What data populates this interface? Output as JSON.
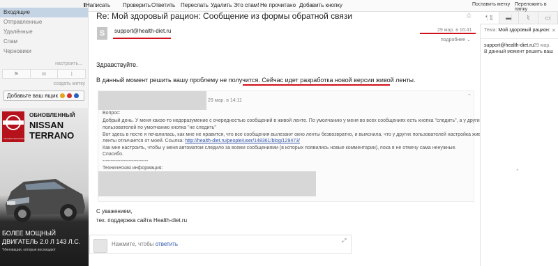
{
  "sidebar": {
    "folders": [
      "Входящие",
      "Отправленные",
      "Удалённые",
      "Спам",
      "Черновики"
    ],
    "configure": "настроить...",
    "create_note": "создать метку",
    "add_box": "Добавьте ваш ящик"
  },
  "ad": {
    "badge_tag": "Innovation that excites",
    "line1": "ОБНОВЛЕННЫЙ",
    "line2": "NISSAN",
    "line3": "TERRANO",
    "bottom1": "БОЛЕЕ МОЩНЫЙ",
    "bottom2": "ДВИГАТЕЛЬ 2.0 Л 143 Л.С.",
    "bottom3": "*Инновации, которые восхищают"
  },
  "toolbar": {
    "buttons": [
      "Написать",
      "Проверить",
      "Ответить",
      "Переслать",
      "Удалить",
      "Это спам!",
      "Не прочитано",
      "Добавить кнопку"
    ],
    "right1": "Поставить метку",
    "right2": "Переложить в папку"
  },
  "message": {
    "subject": "Re: Мой здоровый рацион: Сообщение из формы обратной связи",
    "avatar_letter": "S",
    "sender": "support@health-diet.ru",
    "date": "29 мар. в 16:41",
    "more": "подробнее",
    "greeting": "Здравствуйте.",
    "line1_a": "В данный момент решить вашу проблему не получится. ",
    "line1_b": "Сейчас идет разработка новой версии живой ленты.",
    "quote": {
      "date": "29 мар. в 14:11",
      "label": "Вопрос:",
      "p1": "Добрый день. У меня какое-то недоразумение с очередностью сообщений в живой ленте. По умолчанию у меня во всех сообщениях есть кнопка \"следить\", а у других",
      "p2": "пользователей по умолчанию кнопка \"не следить\"",
      "p3": "Вот здесь в посте я печалилась, как мне не нравится, что все сообщения вылезают окно ленты безвозвратно, и выяснила, что у других пользователей настройка живой",
      "p4_a": "ленты отличается от моей. Ссылка: ",
      "p4_link": "http://health-diet.ru/people/user/148361/blog/129473/",
      "p5": "Как мне настроить, чтобы у меня автоматом следило за всеми сообщениями (в которых появились новые комментарии), пока я не отмечу сама ненужные.",
      "p6": "Спасибо.",
      "p7": "----------------------------",
      "p8": "Техническая информация:"
    },
    "sig1": "С уважением,",
    "sig2": "тех. поддержка сайта Health-diet.ru",
    "reply_prefix": "Нажмите, чтобы ",
    "reply_link": "ответить"
  },
  "right_panel": {
    "subject_label": "Тема: ",
    "subject_value": "Мой здоровый рацион:",
    "from": "support@health-diet.ru",
    "date": "29 мар.",
    "preview": "В данный момент решить ваш",
    "tab_count": "1"
  }
}
